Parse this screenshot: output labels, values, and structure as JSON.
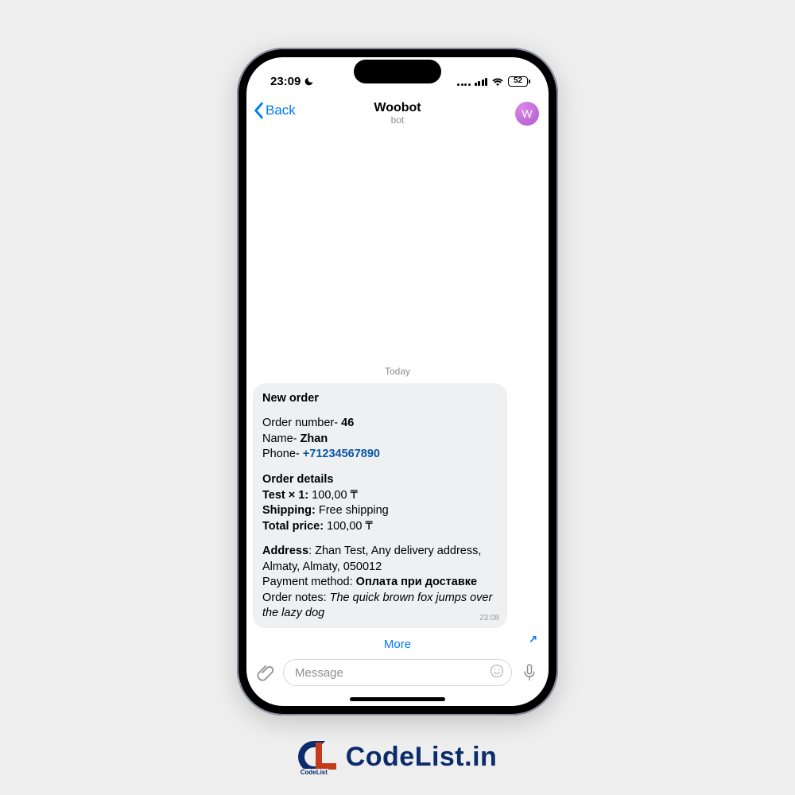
{
  "status": {
    "time": "23:09",
    "battery": "52"
  },
  "nav": {
    "back": "Back",
    "title": "Woobot",
    "subtitle": "bot"
  },
  "avatar_letter": "W",
  "chat": {
    "date": "Today",
    "msg_time": "23:08",
    "more": "More",
    "title": "New order",
    "order_number_label": "Order number- ",
    "order_number": "46",
    "name_label": "Name- ",
    "name": "Zhan",
    "phone_label": "Phone- ",
    "phone": "+71234567890",
    "details_label": "Order details",
    "line_item_label": "Test × 1:",
    "line_item_value": " 100,00 ₸",
    "shipping_label": "Shipping:",
    "shipping_value": " Free shipping",
    "total_label": "Total price:",
    "total_value": " 100,00 ₸",
    "address_label": "Address",
    "address_value": ": Zhan Test, Any delivery address, Almaty, Almaty, 050012",
    "payment_label": "Payment method: ",
    "payment_value": "Оплата при доставке",
    "notes_label": "Order notes: ",
    "notes_value": "The quick brown fox jumps over the lazy dog"
  },
  "input": {
    "placeholder": "Message"
  },
  "footer": {
    "tag": "CodeList",
    "text": "CodeList.in"
  }
}
